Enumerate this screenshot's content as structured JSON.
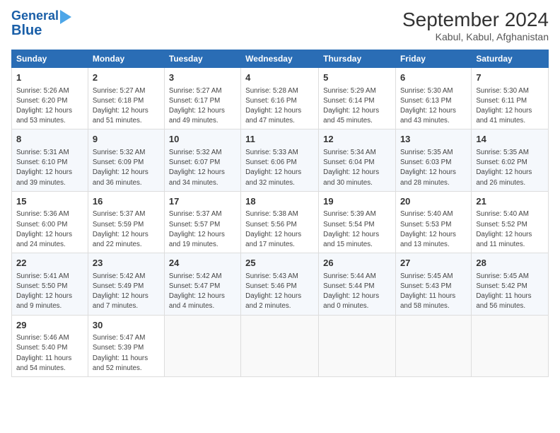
{
  "logo": {
    "line1": "General",
    "line2": "Blue"
  },
  "title": "September 2024",
  "subtitle": "Kabul, Kabul, Afghanistan",
  "weekdays": [
    "Sunday",
    "Monday",
    "Tuesday",
    "Wednesday",
    "Thursday",
    "Friday",
    "Saturday"
  ],
  "weeks": [
    [
      {
        "day": "1",
        "sunrise": "Sunrise: 5:26 AM",
        "sunset": "Sunset: 6:20 PM",
        "daylight": "Daylight: 12 hours and 53 minutes."
      },
      {
        "day": "2",
        "sunrise": "Sunrise: 5:27 AM",
        "sunset": "Sunset: 6:18 PM",
        "daylight": "Daylight: 12 hours and 51 minutes."
      },
      {
        "day": "3",
        "sunrise": "Sunrise: 5:27 AM",
        "sunset": "Sunset: 6:17 PM",
        "daylight": "Daylight: 12 hours and 49 minutes."
      },
      {
        "day": "4",
        "sunrise": "Sunrise: 5:28 AM",
        "sunset": "Sunset: 6:16 PM",
        "daylight": "Daylight: 12 hours and 47 minutes."
      },
      {
        "day": "5",
        "sunrise": "Sunrise: 5:29 AM",
        "sunset": "Sunset: 6:14 PM",
        "daylight": "Daylight: 12 hours and 45 minutes."
      },
      {
        "day": "6",
        "sunrise": "Sunrise: 5:30 AM",
        "sunset": "Sunset: 6:13 PM",
        "daylight": "Daylight: 12 hours and 43 minutes."
      },
      {
        "day": "7",
        "sunrise": "Sunrise: 5:30 AM",
        "sunset": "Sunset: 6:11 PM",
        "daylight": "Daylight: 12 hours and 41 minutes."
      }
    ],
    [
      {
        "day": "8",
        "sunrise": "Sunrise: 5:31 AM",
        "sunset": "Sunset: 6:10 PM",
        "daylight": "Daylight: 12 hours and 39 minutes."
      },
      {
        "day": "9",
        "sunrise": "Sunrise: 5:32 AM",
        "sunset": "Sunset: 6:09 PM",
        "daylight": "Daylight: 12 hours and 36 minutes."
      },
      {
        "day": "10",
        "sunrise": "Sunrise: 5:32 AM",
        "sunset": "Sunset: 6:07 PM",
        "daylight": "Daylight: 12 hours and 34 minutes."
      },
      {
        "day": "11",
        "sunrise": "Sunrise: 5:33 AM",
        "sunset": "Sunset: 6:06 PM",
        "daylight": "Daylight: 12 hours and 32 minutes."
      },
      {
        "day": "12",
        "sunrise": "Sunrise: 5:34 AM",
        "sunset": "Sunset: 6:04 PM",
        "daylight": "Daylight: 12 hours and 30 minutes."
      },
      {
        "day": "13",
        "sunrise": "Sunrise: 5:35 AM",
        "sunset": "Sunset: 6:03 PM",
        "daylight": "Daylight: 12 hours and 28 minutes."
      },
      {
        "day": "14",
        "sunrise": "Sunrise: 5:35 AM",
        "sunset": "Sunset: 6:02 PM",
        "daylight": "Daylight: 12 hours and 26 minutes."
      }
    ],
    [
      {
        "day": "15",
        "sunrise": "Sunrise: 5:36 AM",
        "sunset": "Sunset: 6:00 PM",
        "daylight": "Daylight: 12 hours and 24 minutes."
      },
      {
        "day": "16",
        "sunrise": "Sunrise: 5:37 AM",
        "sunset": "Sunset: 5:59 PM",
        "daylight": "Daylight: 12 hours and 22 minutes."
      },
      {
        "day": "17",
        "sunrise": "Sunrise: 5:37 AM",
        "sunset": "Sunset: 5:57 PM",
        "daylight": "Daylight: 12 hours and 19 minutes."
      },
      {
        "day": "18",
        "sunrise": "Sunrise: 5:38 AM",
        "sunset": "Sunset: 5:56 PM",
        "daylight": "Daylight: 12 hours and 17 minutes."
      },
      {
        "day": "19",
        "sunrise": "Sunrise: 5:39 AM",
        "sunset": "Sunset: 5:54 PM",
        "daylight": "Daylight: 12 hours and 15 minutes."
      },
      {
        "day": "20",
        "sunrise": "Sunrise: 5:40 AM",
        "sunset": "Sunset: 5:53 PM",
        "daylight": "Daylight: 12 hours and 13 minutes."
      },
      {
        "day": "21",
        "sunrise": "Sunrise: 5:40 AM",
        "sunset": "Sunset: 5:52 PM",
        "daylight": "Daylight: 12 hours and 11 minutes."
      }
    ],
    [
      {
        "day": "22",
        "sunrise": "Sunrise: 5:41 AM",
        "sunset": "Sunset: 5:50 PM",
        "daylight": "Daylight: 12 hours and 9 minutes."
      },
      {
        "day": "23",
        "sunrise": "Sunrise: 5:42 AM",
        "sunset": "Sunset: 5:49 PM",
        "daylight": "Daylight: 12 hours and 7 minutes."
      },
      {
        "day": "24",
        "sunrise": "Sunrise: 5:42 AM",
        "sunset": "Sunset: 5:47 PM",
        "daylight": "Daylight: 12 hours and 4 minutes."
      },
      {
        "day": "25",
        "sunrise": "Sunrise: 5:43 AM",
        "sunset": "Sunset: 5:46 PM",
        "daylight": "Daylight: 12 hours and 2 minutes."
      },
      {
        "day": "26",
        "sunrise": "Sunrise: 5:44 AM",
        "sunset": "Sunset: 5:44 PM",
        "daylight": "Daylight: 12 hours and 0 minutes."
      },
      {
        "day": "27",
        "sunrise": "Sunrise: 5:45 AM",
        "sunset": "Sunset: 5:43 PM",
        "daylight": "Daylight: 11 hours and 58 minutes."
      },
      {
        "day": "28",
        "sunrise": "Sunrise: 5:45 AM",
        "sunset": "Sunset: 5:42 PM",
        "daylight": "Daylight: 11 hours and 56 minutes."
      }
    ],
    [
      {
        "day": "29",
        "sunrise": "Sunrise: 5:46 AM",
        "sunset": "Sunset: 5:40 PM",
        "daylight": "Daylight: 11 hours and 54 minutes."
      },
      {
        "day": "30",
        "sunrise": "Sunrise: 5:47 AM",
        "sunset": "Sunset: 5:39 PM",
        "daylight": "Daylight: 11 hours and 52 minutes."
      },
      null,
      null,
      null,
      null,
      null
    ]
  ]
}
